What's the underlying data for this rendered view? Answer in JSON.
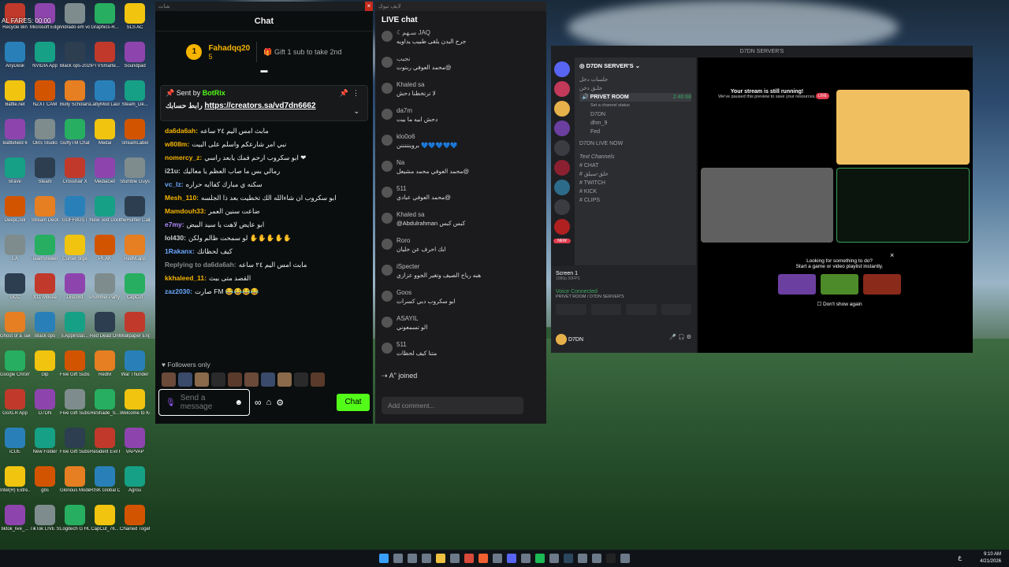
{
  "desktop": {
    "col1": [
      "Recycle Bin",
      "AnyDesk",
      "Battle.net",
      "Battlefield 6",
      "Brave",
      "DeepCool",
      "EA",
      "GCC",
      "Ghost of a Tale",
      "Google Chrome",
      "GoXLR App",
      "iCUE",
      "Intel(R) Extre...",
      "tiktok_live_..."
    ],
    "col2": [
      "Microsoft Edge",
      "NVIDIA App",
      "NZXT CAM",
      "OBS Studio",
      "Steam",
      "Stream Deck",
      "TeamViewer",
      "X11 Mouse",
      "Black ops",
      "clip",
      "D7DN",
      "New Folder",
      "gbs",
      "TikTok LIVE Studio"
    ],
    "col3": [
      "Vidrado em voce",
      "Black ops-2025...",
      "Bully Scholarsh...",
      "GuffyTM Chat",
      "Crosshair X",
      "GUFFBUST",
      "CurseForge",
      "Discord",
      "EAppinstal...",
      "Five Gift Subs (1)",
      "Five Gift Subs",
      "Five Gift Subs-2025...",
      "Glorious Model...",
      "Logitech G HUB"
    ],
    "col4": [
      "Graphics-R...",
      "IPTVSmarte...",
      "LabyMod Launcher",
      "Medal",
      "MediaGet",
      "New Text Document",
      "PEAK",
      "Pummel Party",
      "Red Dead Online",
      "RedM",
      "ReShade_S...",
      "Resident Evil Requiem",
      "RISK Global Domination",
      "CapCut_76..."
    ],
    "col5": [
      "SLS AC",
      "Soundpad",
      "Steam_De...",
      "StreamLabel",
      "Stumble Guys",
      "theHunter Call of t...",
      "RedM.app",
      "CapCut",
      "Wallpaper Engine",
      "War Thunder",
      "Welcome to Kowloon",
      "VAPVAP",
      "Agrou",
      "Chained Together"
    ],
    "overlay_text": "AL FARES: 00:00"
  },
  "kick": {
    "window_title": "شات",
    "header": "Chat",
    "gifter_name": "Fahadqq20",
    "gifter_rank": "1",
    "gifter_count": "5",
    "gift_cta": "Gift 1 sub to take 2nd",
    "pinned_by": "Sent by",
    "pinned_user": "BotRix",
    "pinned_text": "رابط حسابك",
    "pinned_link": "https://creators.sa/vd7dn6662",
    "messages": [
      {
        "user": "da6da6ah:",
        "text": "مابث امس اليم ٢٤ ساعه",
        "color": "#f5b400"
      },
      {
        "user": "w808m:",
        "text": "نبي امر شارعكم واسلم على البيت",
        "color": "#f5b400"
      },
      {
        "user": "nomercy_z:",
        "text": "ابو سكروب ارحم فمك يابعد راسي ❤",
        "color": "#f5b400"
      },
      {
        "user": "i21u:",
        "text": "رمالي بس ما صاب العظم يا معاليك",
        "color": "#cfcfcf"
      },
      {
        "user": "vc_lz:",
        "text": "سكنه ي مبارك كفاايه حراره",
        "color": "#6aa8ff"
      },
      {
        "user": "Mesh_110:",
        "text": "ابو سكروب ان شاءالله الك تخطيت بعد ذا الجلسه",
        "color": "#f5b400"
      },
      {
        "user": "Mamdouh33:",
        "text": "ضاعت سنين العمر",
        "color": "#f5b400"
      },
      {
        "user": "e7my:",
        "text": "ابو عايض لاهت يا سيد البيض",
        "color": "#b28cff"
      },
      {
        "user": "lol430:",
        "text": "لو سمحت ظالم ولكن ✋✋✋✋✋",
        "color": "#cfcfcf"
      },
      {
        "user": "1Rakanx:",
        "text": "كيف لحظاتك",
        "color": "#6aa8ff"
      },
      {
        "user": "Replying to da6da6ah:",
        "text": "مابث امس اليم ٢٤ ساعه",
        "color": "#8a8a8a"
      },
      {
        "user": "kkhaleed_11:",
        "text": "القصد متى ببث",
        "color": "#f5b400"
      },
      {
        "user": "zaz2030:",
        "text": "صارت FM 😂😂😂😂",
        "color": "#6aa8ff"
      }
    ],
    "followers_label": "Followers only",
    "input_placeholder": "Send a message",
    "chat_button": "Chat"
  },
  "tiktok": {
    "window_title": "لايف تيوك",
    "header": "LIVE chat",
    "items": [
      {
        "name": "☾سـهم JAQ",
        "text": "جرح البدن يلقى طبيب يداويه"
      },
      {
        "name": "نجيب",
        "text": "محمد العوفي ربتوت@"
      },
      {
        "name": "Khaled sa",
        "text": "لا ترتخطنا دحش"
      },
      {
        "name": "da7m",
        "text": "دحش ابيه ما بيت"
      },
      {
        "name": "klo0o6",
        "text": "بروينننننن 💙💙💙💙💙"
      },
      {
        "name": "Na",
        "text": "محمد العوفي محمد مشيعل@"
      },
      {
        "name": "511",
        "text": "محمد العوفي عبادي@"
      },
      {
        "name": "Khaled sa",
        "text": "@Abdulrahman كبس كبس"
      },
      {
        "name": "Roro",
        "text": "ابك احرف عن حليان"
      },
      {
        "name": "iSpecter",
        "text": "هبه رياح الصيف وتغير الجوو عزازي"
      },
      {
        "name": "Goos",
        "text": "ابو سكروب دبي كسرات"
      },
      {
        "name": "ASAYIL",
        "text": "الو تسمعوني"
      },
      {
        "name": "511",
        "text": "متنا كيف لحظات"
      }
    ],
    "joined": "A\" joined",
    "comment_placeholder": "Add comment..."
  },
  "discord": {
    "window_title": "D7DN SERVER'S",
    "server_name": "D7DN SERVER'S",
    "category1": "جلسات دخل",
    "channel_welcome": "حلـق دخن",
    "channel_voice": "PRIVET ROOM",
    "channel_status": "Set a channel status",
    "timer": "2:46:68",
    "live_badge": "LIVE",
    "members": [
      "D7DN",
      "dhm_9",
      "Fed"
    ],
    "channel_live": "D7DN LIVE NOW",
    "text_category": "Text Channels",
    "text_channels": [
      "CHAT",
      "خلق-سيلق",
      "TWITCH",
      "KICK",
      "CLIPS"
    ],
    "new_badge": "NEW",
    "screen_label": "Screen 1",
    "screen_sub": "1080p 30FPS",
    "voice_status": "Voice Connected",
    "voice_sub": "PRIVET ROOM / D7DN SERVER'S",
    "user_name": "D7DN",
    "stream_title": "Your stream is still running!",
    "stream_sub": "We've paused this preview to save your resources.",
    "looking_title": "Looking for something to do?",
    "looking_sub": "Start a game or video playlist instantly.",
    "dont_show": "Don't show again"
  },
  "taskbar": {
    "time": "9:10 AM",
    "date": "4/21/2026",
    "lang": "ع"
  }
}
